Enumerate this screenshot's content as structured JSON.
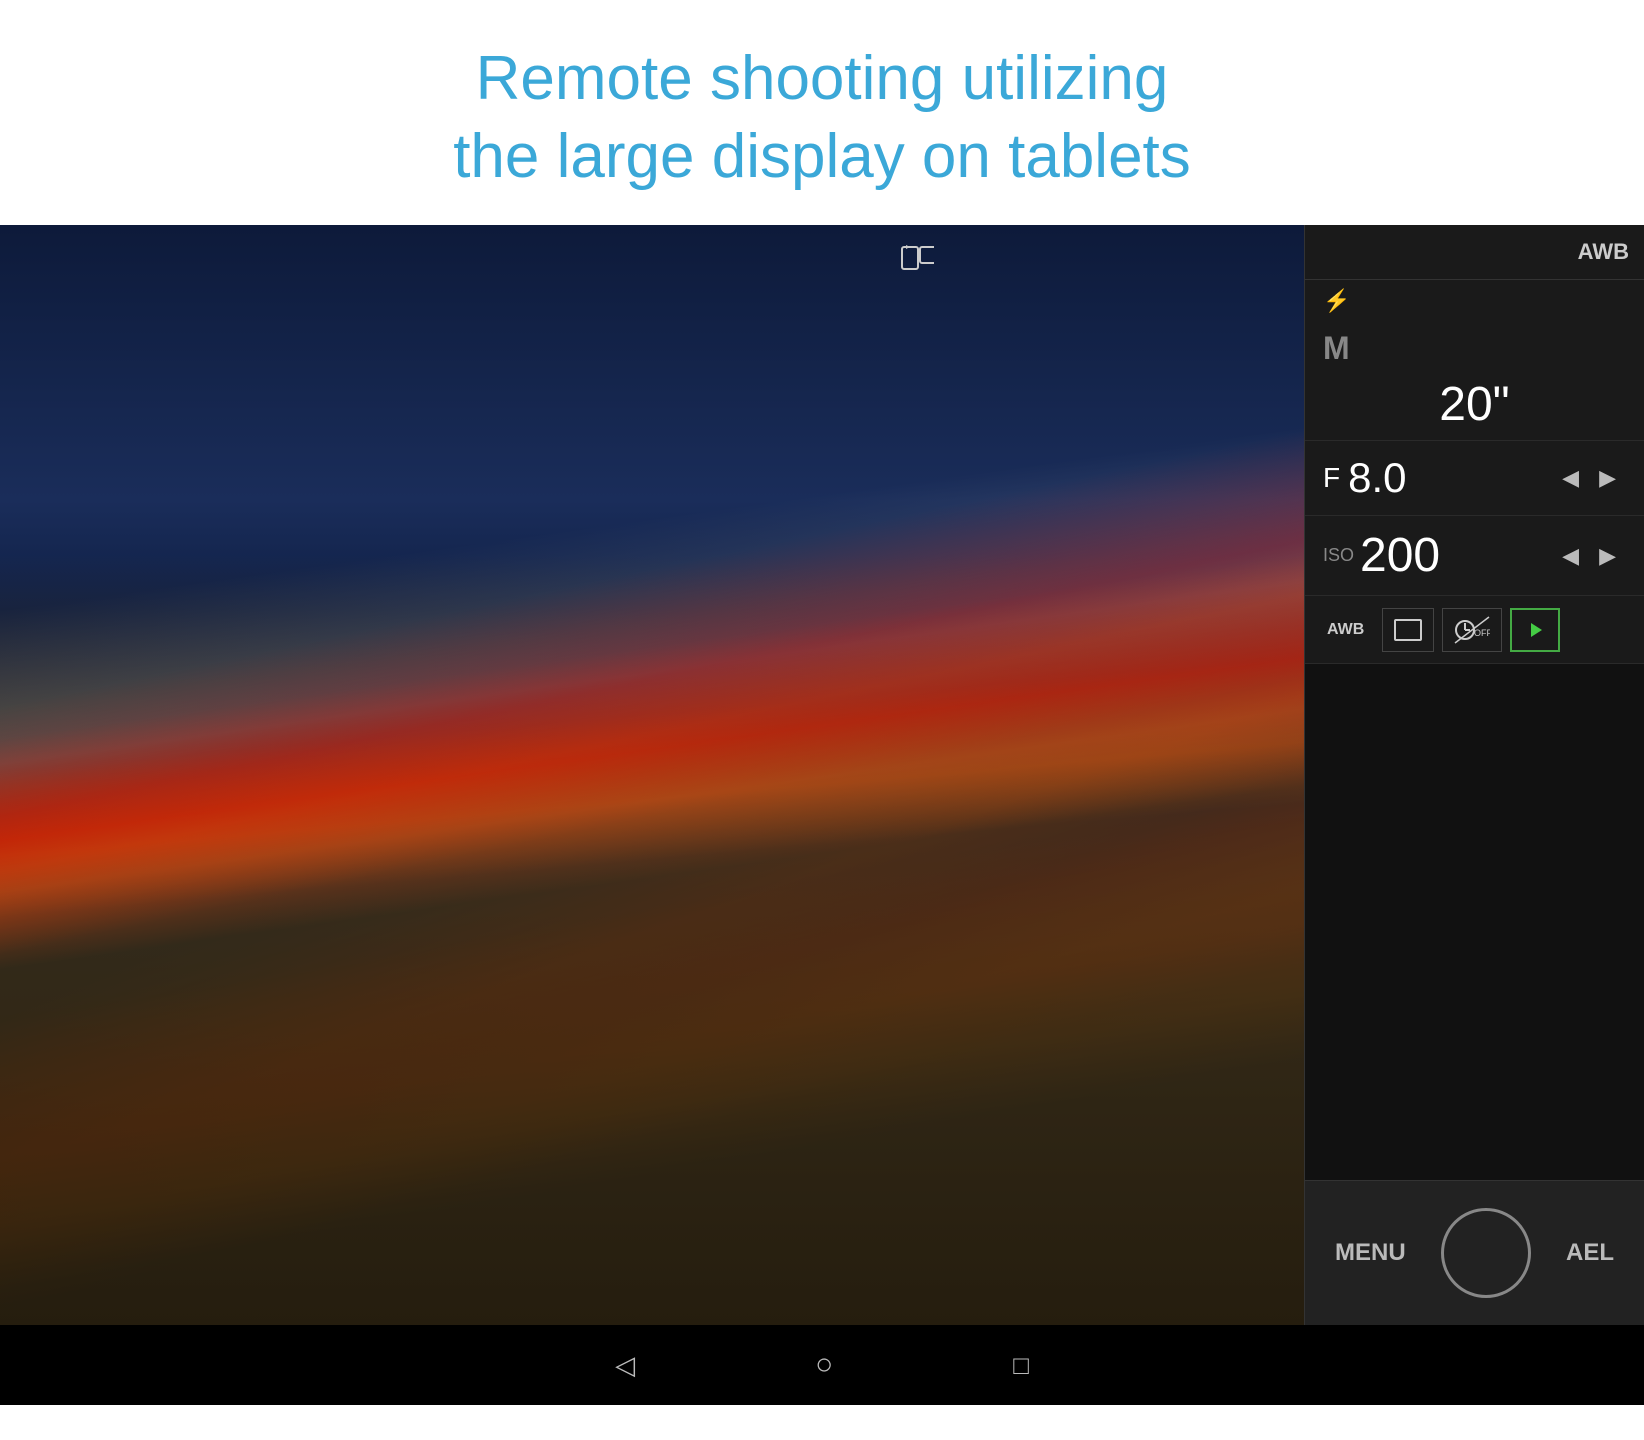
{
  "title": {
    "line1": "Remote shooting utilizing the large display on tablets",
    "line1a": "Remote shooting utilizing",
    "line1b": "the large display on tablets"
  },
  "controls": {
    "awb": "AWB",
    "flash_icon": "⚡",
    "mode": "M",
    "shutter_speed": "20\"",
    "fstop_label": "F",
    "fstop_value": "8.0",
    "iso_label": "ISO",
    "iso_value": "200",
    "arrow_left": "◀",
    "arrow_right": "▶",
    "awb_btn": "AWB",
    "rect_icon": "☐",
    "coff_label": "C̶OFF",
    "play_icon": "▶",
    "menu_label": "MENU",
    "ael_label": "AEL"
  },
  "nav": {
    "back_icon": "◁",
    "home_icon": "○",
    "recent_icon": "□"
  },
  "icons": {
    "rotate_portrait": "⟲",
    "rotate_landscape": "⟳"
  }
}
